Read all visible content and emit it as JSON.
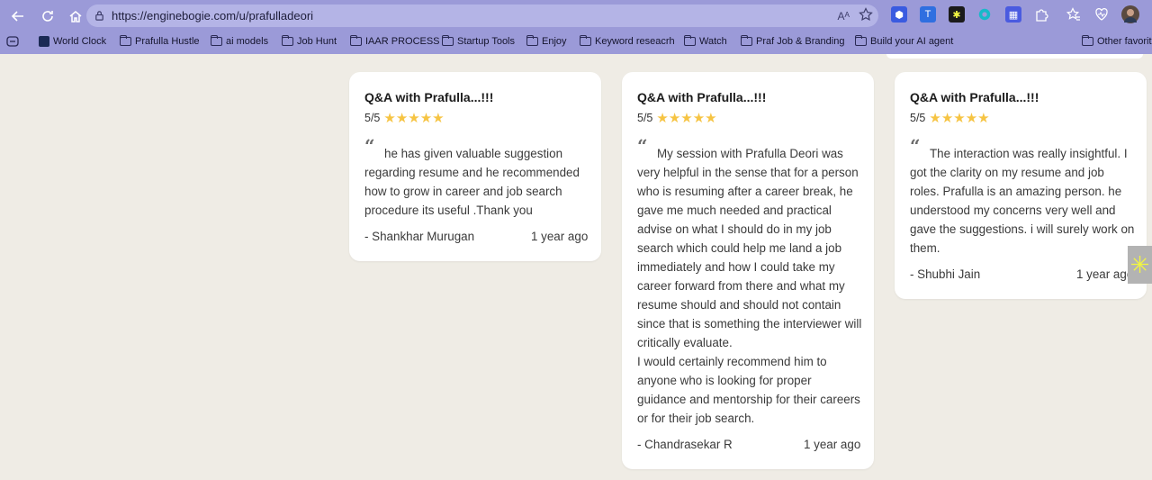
{
  "browser": {
    "url": "https://enginebogie.com/u/prafulladeori",
    "reader_icon": "Aᴬ",
    "bookmarks": [
      "World Clock",
      "Prafulla Hustle",
      "ai models",
      "Job Hunt",
      "IAAR PROCESS",
      "Startup Tools",
      "Enjoy",
      "Keyword reseacrh",
      "Watch",
      "Praf Job & Branding",
      "Build your AI agent"
    ],
    "other_favorites": "Other favorit"
  },
  "reviews": [
    {
      "title": "Q&A with Prafulla...!!!",
      "rating": "5/5",
      "stars": "★★★★★",
      "text": "he has given valuable suggestion regarding resume and he recommended how to grow in career and job search procedure its useful .Thank you",
      "text_extra": "",
      "author": "- Shankhar Murugan",
      "time": "1 year ago"
    },
    {
      "title": "Q&A with Prafulla...!!!",
      "rating": "5/5",
      "stars": "★★★★★",
      "text": "My session with Prafulla Deori was very helpful in the sense that for a person who is resuming after a career break, he gave me much needed and practical advise on what I should do in my job search which could help me land a job immediately and how I could take my career forward from there and what my resume should and should not contain since that is something the interviewer will critically evaluate.",
      "text_extra": "I would certainly recommend him to anyone who is looking for proper guidance and mentorship for their careers or for their job search.",
      "author": "- Chandrasekar R",
      "time": "1 year ago"
    },
    {
      "title": "Q&A with Prafulla...!!!",
      "rating": "5/5",
      "stars": "★★★★★",
      "text": "The interaction was really insightful. I got the clarity on my resume and job roles. Prafulla is an amazing person. he understood my concerns very well and gave the suggestions. i will surely work on them.",
      "text_extra": "",
      "author": "- Shubhi Jain",
      "time": "1 year ago"
    }
  ],
  "quote_glyph": "“",
  "side_widget_glyph": "✳"
}
